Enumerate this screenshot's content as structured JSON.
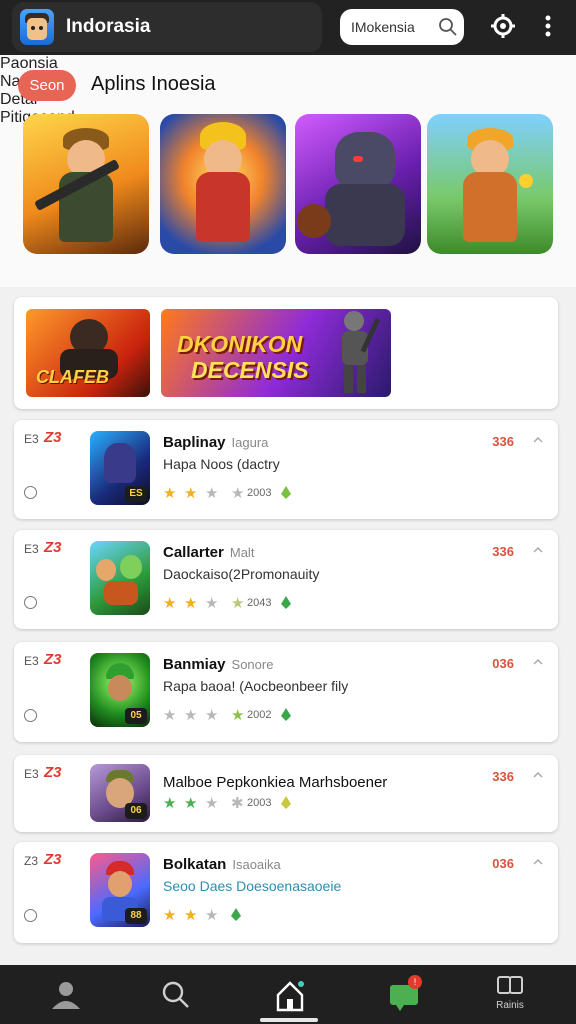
{
  "header": {
    "app_title": "Indorasia",
    "search_text": "IMokensia"
  },
  "featured": {
    "badge": "Seon",
    "title": "Aplins Inoesia",
    "items": [
      {
        "caption": "Paonsia"
      },
      {
        "caption": "Natgor"
      },
      {
        "caption": "Detai"
      },
      {
        "caption": "Pitigesand"
      }
    ]
  },
  "banner": {
    "left_text": "CLAFEB",
    "line1": "DKONIKON",
    "line2": "DECENSIS"
  },
  "list": [
    {
      "rank": "E3",
      "flag": "Z3",
      "name": "Baplinay",
      "sub": "Iagura",
      "desc": "Hapa Noos (dactry",
      "count": "2003",
      "price": "336",
      "tag": "ES"
    },
    {
      "rank": "E3",
      "flag": "Z3",
      "name": "Callarter",
      "sub": "Malt",
      "desc": "Daockaiso(2Promonauity",
      "count": "2043",
      "price": "336",
      "tag": ""
    },
    {
      "rank": "E3",
      "flag": "Z3",
      "name": "Banmiay",
      "sub": "Sonore",
      "desc": "Rapa baoa! (Aocbeonbeer fily",
      "count": "2002",
      "price": "036",
      "tag": "05"
    },
    {
      "rank": "E3",
      "flag": "Z3",
      "name": "Malboe Pepkonkiea Marhsboener",
      "sub": "",
      "desc": "",
      "count": "2003",
      "price": "336",
      "tag": "06"
    },
    {
      "rank": "Z3",
      "flag": "Z3",
      "name": "Bolkatan",
      "sub": "Isaoaika",
      "desc": "Seoo Daes Doesoenasaoeie",
      "count": "",
      "price": "036",
      "tag": "88"
    }
  ],
  "bottom_nav": {
    "last_label": "Rainis"
  },
  "colors": {
    "accent": "#e86455",
    "price": "#d9533f",
    "star_gold": "#f2b01e",
    "star_gray": "#b8b8b8",
    "top_bar": "#222222"
  }
}
